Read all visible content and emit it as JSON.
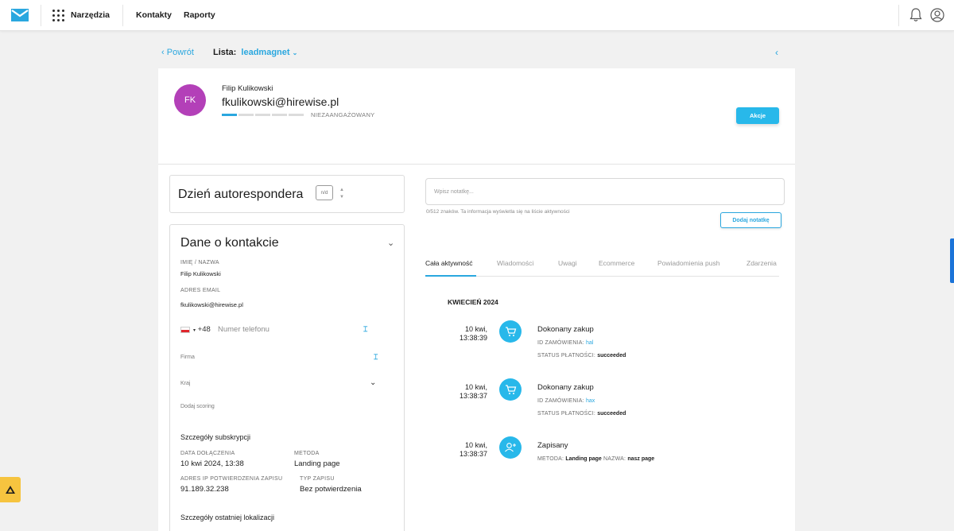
{
  "topbar": {
    "tools_label": "Narzędzia",
    "nav": [
      "Kontakty",
      "Raporty"
    ],
    "icons": [
      "logo-envelope-icon",
      "apps-grid-icon",
      "bell-icon",
      "user-circle-icon"
    ]
  },
  "breadcrumb": {
    "back_label": "Powrót",
    "list_label": "Lista:",
    "list_name": "leadmagnet"
  },
  "contact": {
    "initials": "FK",
    "name": "Filip Kulikowski",
    "email": "fkulikowski@hirewise.pl",
    "engagement_label": "NIEZAANGAŻOWANY",
    "engagement_level": 1,
    "engagement_max": 5,
    "actions_label": "Akcje"
  },
  "autoresponder": {
    "title": "Dzień autorespondera",
    "value": "n/d"
  },
  "details": {
    "title": "Dane o kontakcie",
    "name_label": "IMIĘ / NAZWA",
    "name_value": "Filip Kulikowski",
    "email_label": "ADRES EMAIL",
    "email_value": "fkulikowski@hirewise.pl",
    "phone_code": "+48",
    "phone_placeholder": "Numer telefonu",
    "company_placeholder": "Firma",
    "country_placeholder": "Kraj",
    "scoring_placeholder": "Dodaj scoring"
  },
  "subscription": {
    "title": "Szczegóły subskrypcji",
    "date_label": "DATA DOŁĄCZENIA",
    "date_value": "10 kwi 2024, 13:38",
    "method_label": "METODA",
    "method_value": "Landing page",
    "ip_label": "ADRES IP POTWIERDZENIA ZAPISU",
    "ip_value": "91.189.32.238",
    "type_label": "TYP ZAPISU",
    "type_value": "Bez potwierdzenia"
  },
  "location": {
    "title": "Szczegóły ostatniej lokalizacji"
  },
  "note": {
    "placeholder": "Wpisz notatkę...",
    "help": "0/512 znaków. Ta informacja wyświetla się na liście aktywności",
    "button": "Dodaj notatkę"
  },
  "tabs": [
    "Cała aktywność",
    "Wiadomości",
    "Uwagi",
    "Ecommerce",
    "Powiadomienia push",
    "Zdarzenia"
  ],
  "activity": {
    "month": "KWIECIEŃ 2024",
    "events": [
      {
        "date": "10 kwi,",
        "time": "13:38:39",
        "icon": "cart-icon",
        "title": "Dokonany zakup",
        "l1_label": "ID ZAMÓWIENIA:",
        "l1_value": "hal",
        "l2_label": "STATUS PŁATNOŚCI:",
        "l2_value": "succeeded"
      },
      {
        "date": "10 kwi,",
        "time": "13:38:37",
        "icon": "cart-icon",
        "title": "Dokonany zakup",
        "l1_label": "ID ZAMÓWIENIA:",
        "l1_value": "hax",
        "l2_label": "STATUS PŁATNOŚCI:",
        "l2_value": "succeeded"
      },
      {
        "date": "10 kwi,",
        "time": "13:38:37",
        "icon": "user-add-icon",
        "title": "Zapisany",
        "l1_label": "METODA:",
        "l1_value": "Landing page",
        "l1b_label": "NAZWA:",
        "l1b_value": "nasz page"
      }
    ]
  },
  "colors": {
    "accent": "#2aa7df",
    "button": "#28b8ea",
    "avatar": "#b340b8",
    "help_fab": "#f6c43f"
  }
}
